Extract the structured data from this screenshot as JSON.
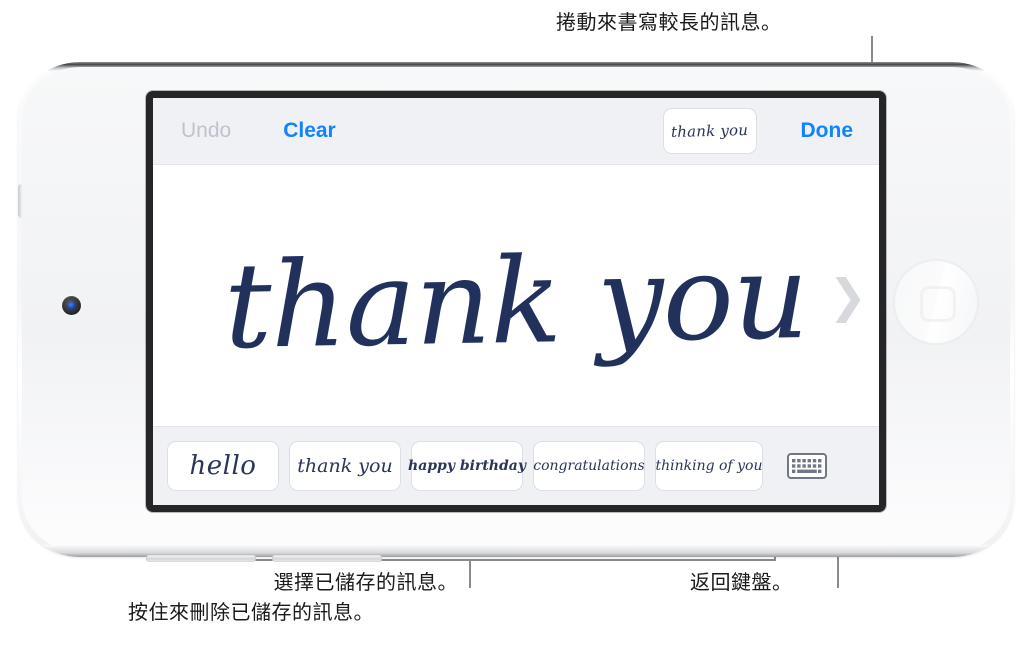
{
  "annotations": {
    "top": "捲動來書寫較長的訊息。",
    "bottom_left_line1": "選擇已儲存的訊息。",
    "bottom_left_line2": "按住來刪除已儲存的訊息。",
    "bottom_right": "返回鍵盤。"
  },
  "screen": {
    "toolbar": {
      "undo_label": "Undo",
      "clear_label": "Clear",
      "preview_thumb_label": "thank you",
      "done_label": "Done"
    },
    "canvas": {
      "handwriting": "thank you",
      "next_chevron": "❯"
    },
    "saved_messages": [
      {
        "label": "hello"
      },
      {
        "label": "thank you"
      },
      {
        "label": "happy birthday"
      },
      {
        "label": "congratulations"
      },
      {
        "label": "thinking of you"
      }
    ],
    "keyboard_button": {
      "icon": "keyboard-icon"
    }
  },
  "colors": {
    "accent_blue": "#1283ff",
    "disabled_gray": "#bfc3cb",
    "ink_navy": "#22305c",
    "screen_chrome": "#eff1f5",
    "bezel": "#262628",
    "chevron_gray": "#d7d9dd",
    "keyboard_icon": "#6e7687"
  }
}
